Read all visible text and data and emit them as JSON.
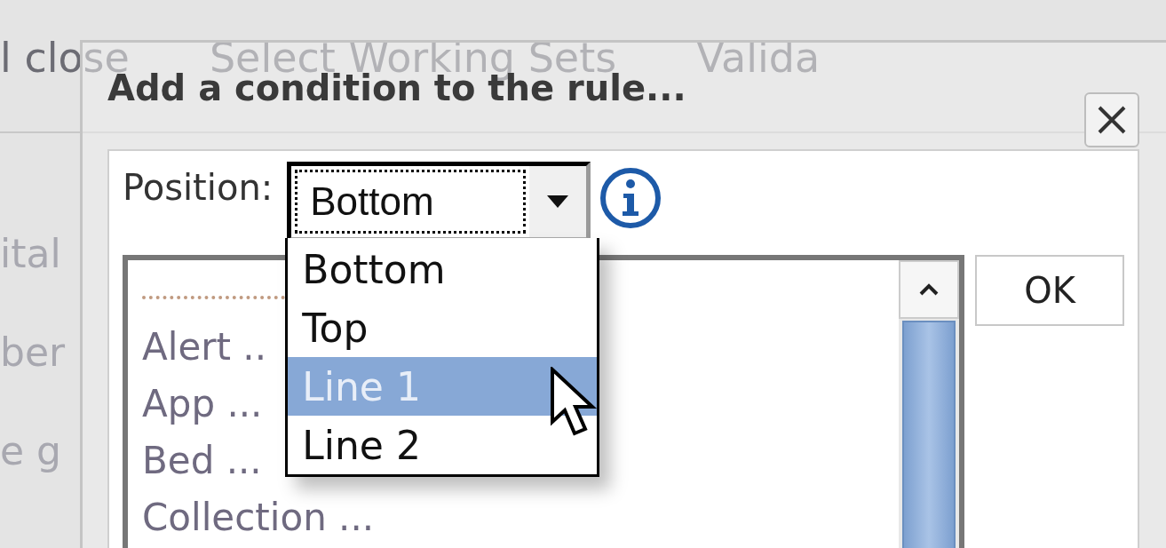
{
  "background": {
    "toolbar": [
      "l close",
      "Select Working Sets",
      "Valida"
    ],
    "sidebar": [
      "ital",
      "ber",
      "e",
      "g"
    ]
  },
  "dialog": {
    "title": "Add a condition to the rule...",
    "position": {
      "label": "Position:",
      "value": "Bottom",
      "open": true,
      "options": [
        {
          "label": "Bottom",
          "highlighted": false
        },
        {
          "label": "Top",
          "highlighted": false
        },
        {
          "label": "Line 1",
          "highlighted": true
        },
        {
          "label": "Line 2",
          "highlighted": false
        }
      ]
    },
    "list": {
      "items": [
        "Alert ..",
        "App ...",
        "Bed ...",
        "Collection ..."
      ]
    },
    "ok": "OK"
  }
}
